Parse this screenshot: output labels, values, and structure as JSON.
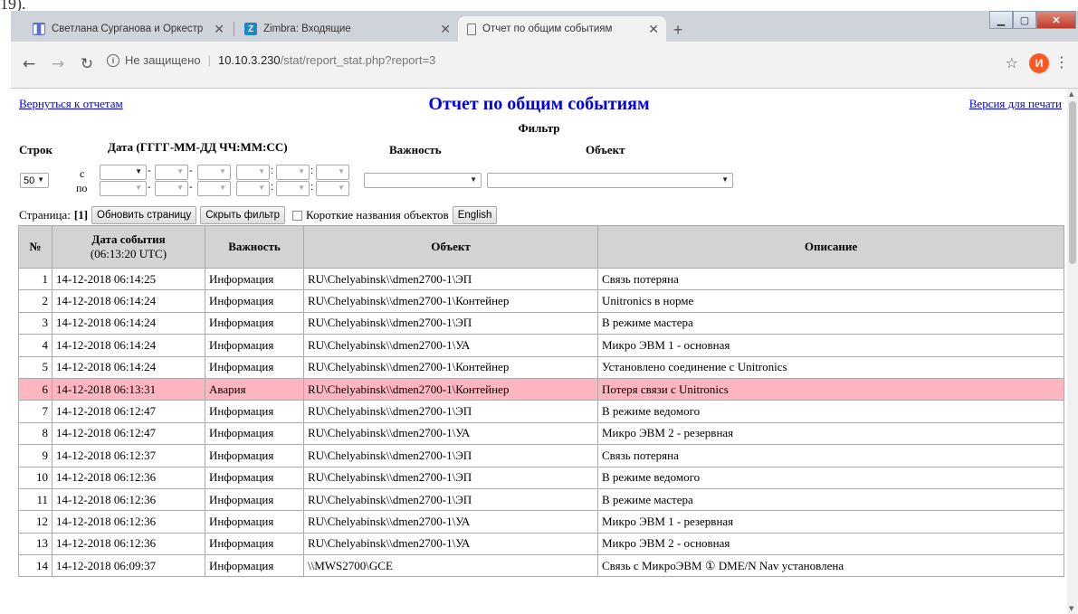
{
  "doc_edge": {
    "text": "19)."
  },
  "browser": {
    "tabs": [
      {
        "title": "Светлана Сурганова и Оркестр",
        "icon": "music-app-icon",
        "active": false
      },
      {
        "title": "Zimbra: Входящие",
        "icon": "zimbra-icon",
        "active": false
      },
      {
        "title": "Отчет по общим событиям",
        "icon": "document-icon",
        "active": true
      }
    ],
    "address": {
      "security_label": "Не защищено",
      "host": "10.10.3.230",
      "path": "/stat/report_stat.php?report=3"
    },
    "profile_initial": "И"
  },
  "page": {
    "back_link": "Вернуться к отчетам",
    "title": "Отчет по общим событиям",
    "print_link": "Версия для печати",
    "filter": {
      "heading": "Фильтр",
      "rows_label": "Строк",
      "date_label": "Дата (ГГГГ-ММ-ДД ЧЧ:ММ:СС)",
      "severity_label": "Важность",
      "object_label": "Объект",
      "rows_value": "50",
      "from_label": "с",
      "to_label": "по"
    },
    "pagebar": {
      "page_label": "Страница:",
      "page_current": "[1]",
      "refresh_button": "Обновить страницу",
      "hide_filter_button": "Скрыть фильтр",
      "short_names_label": "Короткие названия объектов",
      "english_button": "English"
    },
    "table": {
      "headers": {
        "num": "№",
        "date": "Дата события",
        "date_sub": "(06:13:20 UTC)",
        "severity": "Важность",
        "object": "Объект",
        "description": "Описание"
      },
      "rows": [
        {
          "n": "1",
          "date": "14-12-2018 06:14:25",
          "sev": "Информация",
          "obj": "RU\\Chelyabinsk\\\\dmen2700-1\\ЭП",
          "desc": "Связь потеряна"
        },
        {
          "n": "2",
          "date": "14-12-2018 06:14:24",
          "sev": "Информация",
          "obj": "RU\\Chelyabinsk\\\\dmen2700-1\\Контейнер",
          "desc": "Unitronics в норме"
        },
        {
          "n": "3",
          "date": "14-12-2018 06:14:24",
          "sev": "Информация",
          "obj": "RU\\Chelyabinsk\\\\dmen2700-1\\ЭП",
          "desc": "В режиме мастера"
        },
        {
          "n": "4",
          "date": "14-12-2018 06:14:24",
          "sev": "Информация",
          "obj": "RU\\Chelyabinsk\\\\dmen2700-1\\УА",
          "desc": "Микро ЭВМ 1 - основная"
        },
        {
          "n": "5",
          "date": "14-12-2018 06:14:24",
          "sev": "Информация",
          "obj": "RU\\Chelyabinsk\\\\dmen2700-1\\Контейнер",
          "desc": "Установлено соединение с Unitronics"
        },
        {
          "n": "6",
          "date": "14-12-2018 06:13:31",
          "sev": "Авария",
          "obj": "RU\\Chelyabinsk\\\\dmen2700-1\\Контейнер",
          "desc": "Потеря связи с Unitronics"
        },
        {
          "n": "7",
          "date": "14-12-2018 06:12:47",
          "sev": "Информация",
          "obj": "RU\\Chelyabinsk\\\\dmen2700-1\\ЭП",
          "desc": "В режиме ведомого"
        },
        {
          "n": "8",
          "date": "14-12-2018 06:12:47",
          "sev": "Информация",
          "obj": "RU\\Chelyabinsk\\\\dmen2700-1\\УА",
          "desc": "Микро ЭВМ 2 - резервная"
        },
        {
          "n": "9",
          "date": "14-12-2018 06:12:37",
          "sev": "Информация",
          "obj": "RU\\Chelyabinsk\\\\dmen2700-1\\ЭП",
          "desc": "Связь потеряна"
        },
        {
          "n": "10",
          "date": "14-12-2018 06:12:36",
          "sev": "Информация",
          "obj": "RU\\Chelyabinsk\\\\dmen2700-1\\ЭП",
          "desc": "В режиме ведомого"
        },
        {
          "n": "11",
          "date": "14-12-2018 06:12:36",
          "sev": "Информация",
          "obj": "RU\\Chelyabinsk\\\\dmen2700-1\\ЭП",
          "desc": "В режиме мастера"
        },
        {
          "n": "12",
          "date": "14-12-2018 06:12:36",
          "sev": "Информация",
          "obj": "RU\\Chelyabinsk\\\\dmen2700-1\\УА",
          "desc": "Микро ЭВМ 1 - резервная"
        },
        {
          "n": "13",
          "date": "14-12-2018 06:12:36",
          "sev": "Информация",
          "obj": "RU\\Chelyabinsk\\\\dmen2700-1\\УА",
          "desc": "Микро ЭВМ 2 - основная"
        },
        {
          "n": "14",
          "date": "14-12-2018 06:09:37",
          "sev": "Информация",
          "obj": "\\\\MWS2700\\GCE",
          "desc": "Связь с МикроЭВМ ① DME/N Nav установлена"
        }
      ]
    }
  },
  "colors": {
    "link": "#0000ee",
    "header_bg": "#d3d3d3",
    "alarm_row": "#ffb6c1",
    "profile_avatar": "#ff5722"
  }
}
